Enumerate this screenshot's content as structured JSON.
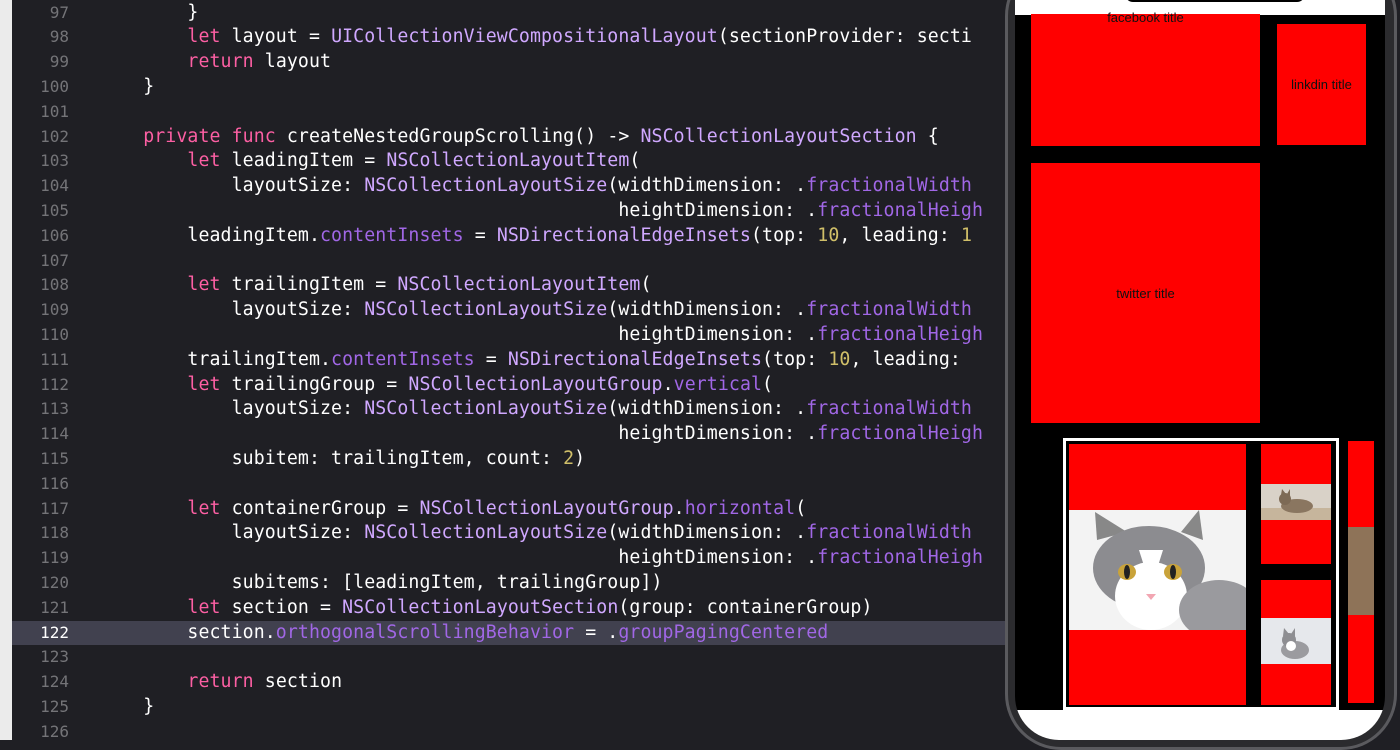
{
  "editor": {
    "current_line": "122",
    "lines": [
      {
        "n": "97",
        "t": "        }"
      },
      {
        "n": "98",
        "t": "        let layout = UICollectionViewCompositionalLayout(sectionProvider: secti"
      },
      {
        "n": "99",
        "t": "        return layout"
      },
      {
        "n": "100",
        "t": "    }"
      },
      {
        "n": "101",
        "t": ""
      },
      {
        "n": "102",
        "t": "    private func createNestedGroupScrolling() -> NSCollectionLayoutSection {"
      },
      {
        "n": "103",
        "t": "        let leadingItem = NSCollectionLayoutItem("
      },
      {
        "n": "104",
        "t": "            layoutSize: NSCollectionLayoutSize(widthDimension: .fractionalWidth"
      },
      {
        "n": "105",
        "t": "                                               heightDimension: .fractionalHeigh"
      },
      {
        "n": "106",
        "t": "        leadingItem.contentInsets = NSDirectionalEdgeInsets(top: 10, leading: 1"
      },
      {
        "n": "107",
        "t": ""
      },
      {
        "n": "108",
        "t": "        let trailingItem = NSCollectionLayoutItem("
      },
      {
        "n": "109",
        "t": "            layoutSize: NSCollectionLayoutSize(widthDimension: .fractionalWidth"
      },
      {
        "n": "110",
        "t": "                                               heightDimension: .fractionalHeigh"
      },
      {
        "n": "111",
        "t": "        trailingItem.contentInsets = NSDirectionalEdgeInsets(top: 10, leading:"
      },
      {
        "n": "112",
        "t": "        let trailingGroup = NSCollectionLayoutGroup.vertical("
      },
      {
        "n": "113",
        "t": "            layoutSize: NSCollectionLayoutSize(widthDimension: .fractionalWidth"
      },
      {
        "n": "114",
        "t": "                                               heightDimension: .fractionalHeigh"
      },
      {
        "n": "115",
        "t": "            subitem: trailingItem, count: 2)"
      },
      {
        "n": "116",
        "t": ""
      },
      {
        "n": "117",
        "t": "        let containerGroup = NSCollectionLayoutGroup.horizontal("
      },
      {
        "n": "118",
        "t": "            layoutSize: NSCollectionLayoutSize(widthDimension: .fractionalWidth"
      },
      {
        "n": "119",
        "t": "                                               heightDimension: .fractionalHeigh"
      },
      {
        "n": "120",
        "t": "            subitems: [leadingItem, trailingGroup])"
      },
      {
        "n": "121",
        "t": "        let section = NSCollectionLayoutSection(group: containerGroup)"
      },
      {
        "n": "122",
        "t": "        section.orthogonalScrollingBehavior = .groupPagingCentered"
      },
      {
        "n": "123",
        "t": ""
      },
      {
        "n": "124",
        "t": "        return section"
      },
      {
        "n": "125",
        "t": "    }"
      },
      {
        "n": "126",
        "t": ""
      }
    ]
  },
  "simulator": {
    "cells": {
      "facebook": "facebook title",
      "linkedin": "linkdin title",
      "twitter": "twitter title"
    },
    "cell_color": "#ff0000"
  }
}
